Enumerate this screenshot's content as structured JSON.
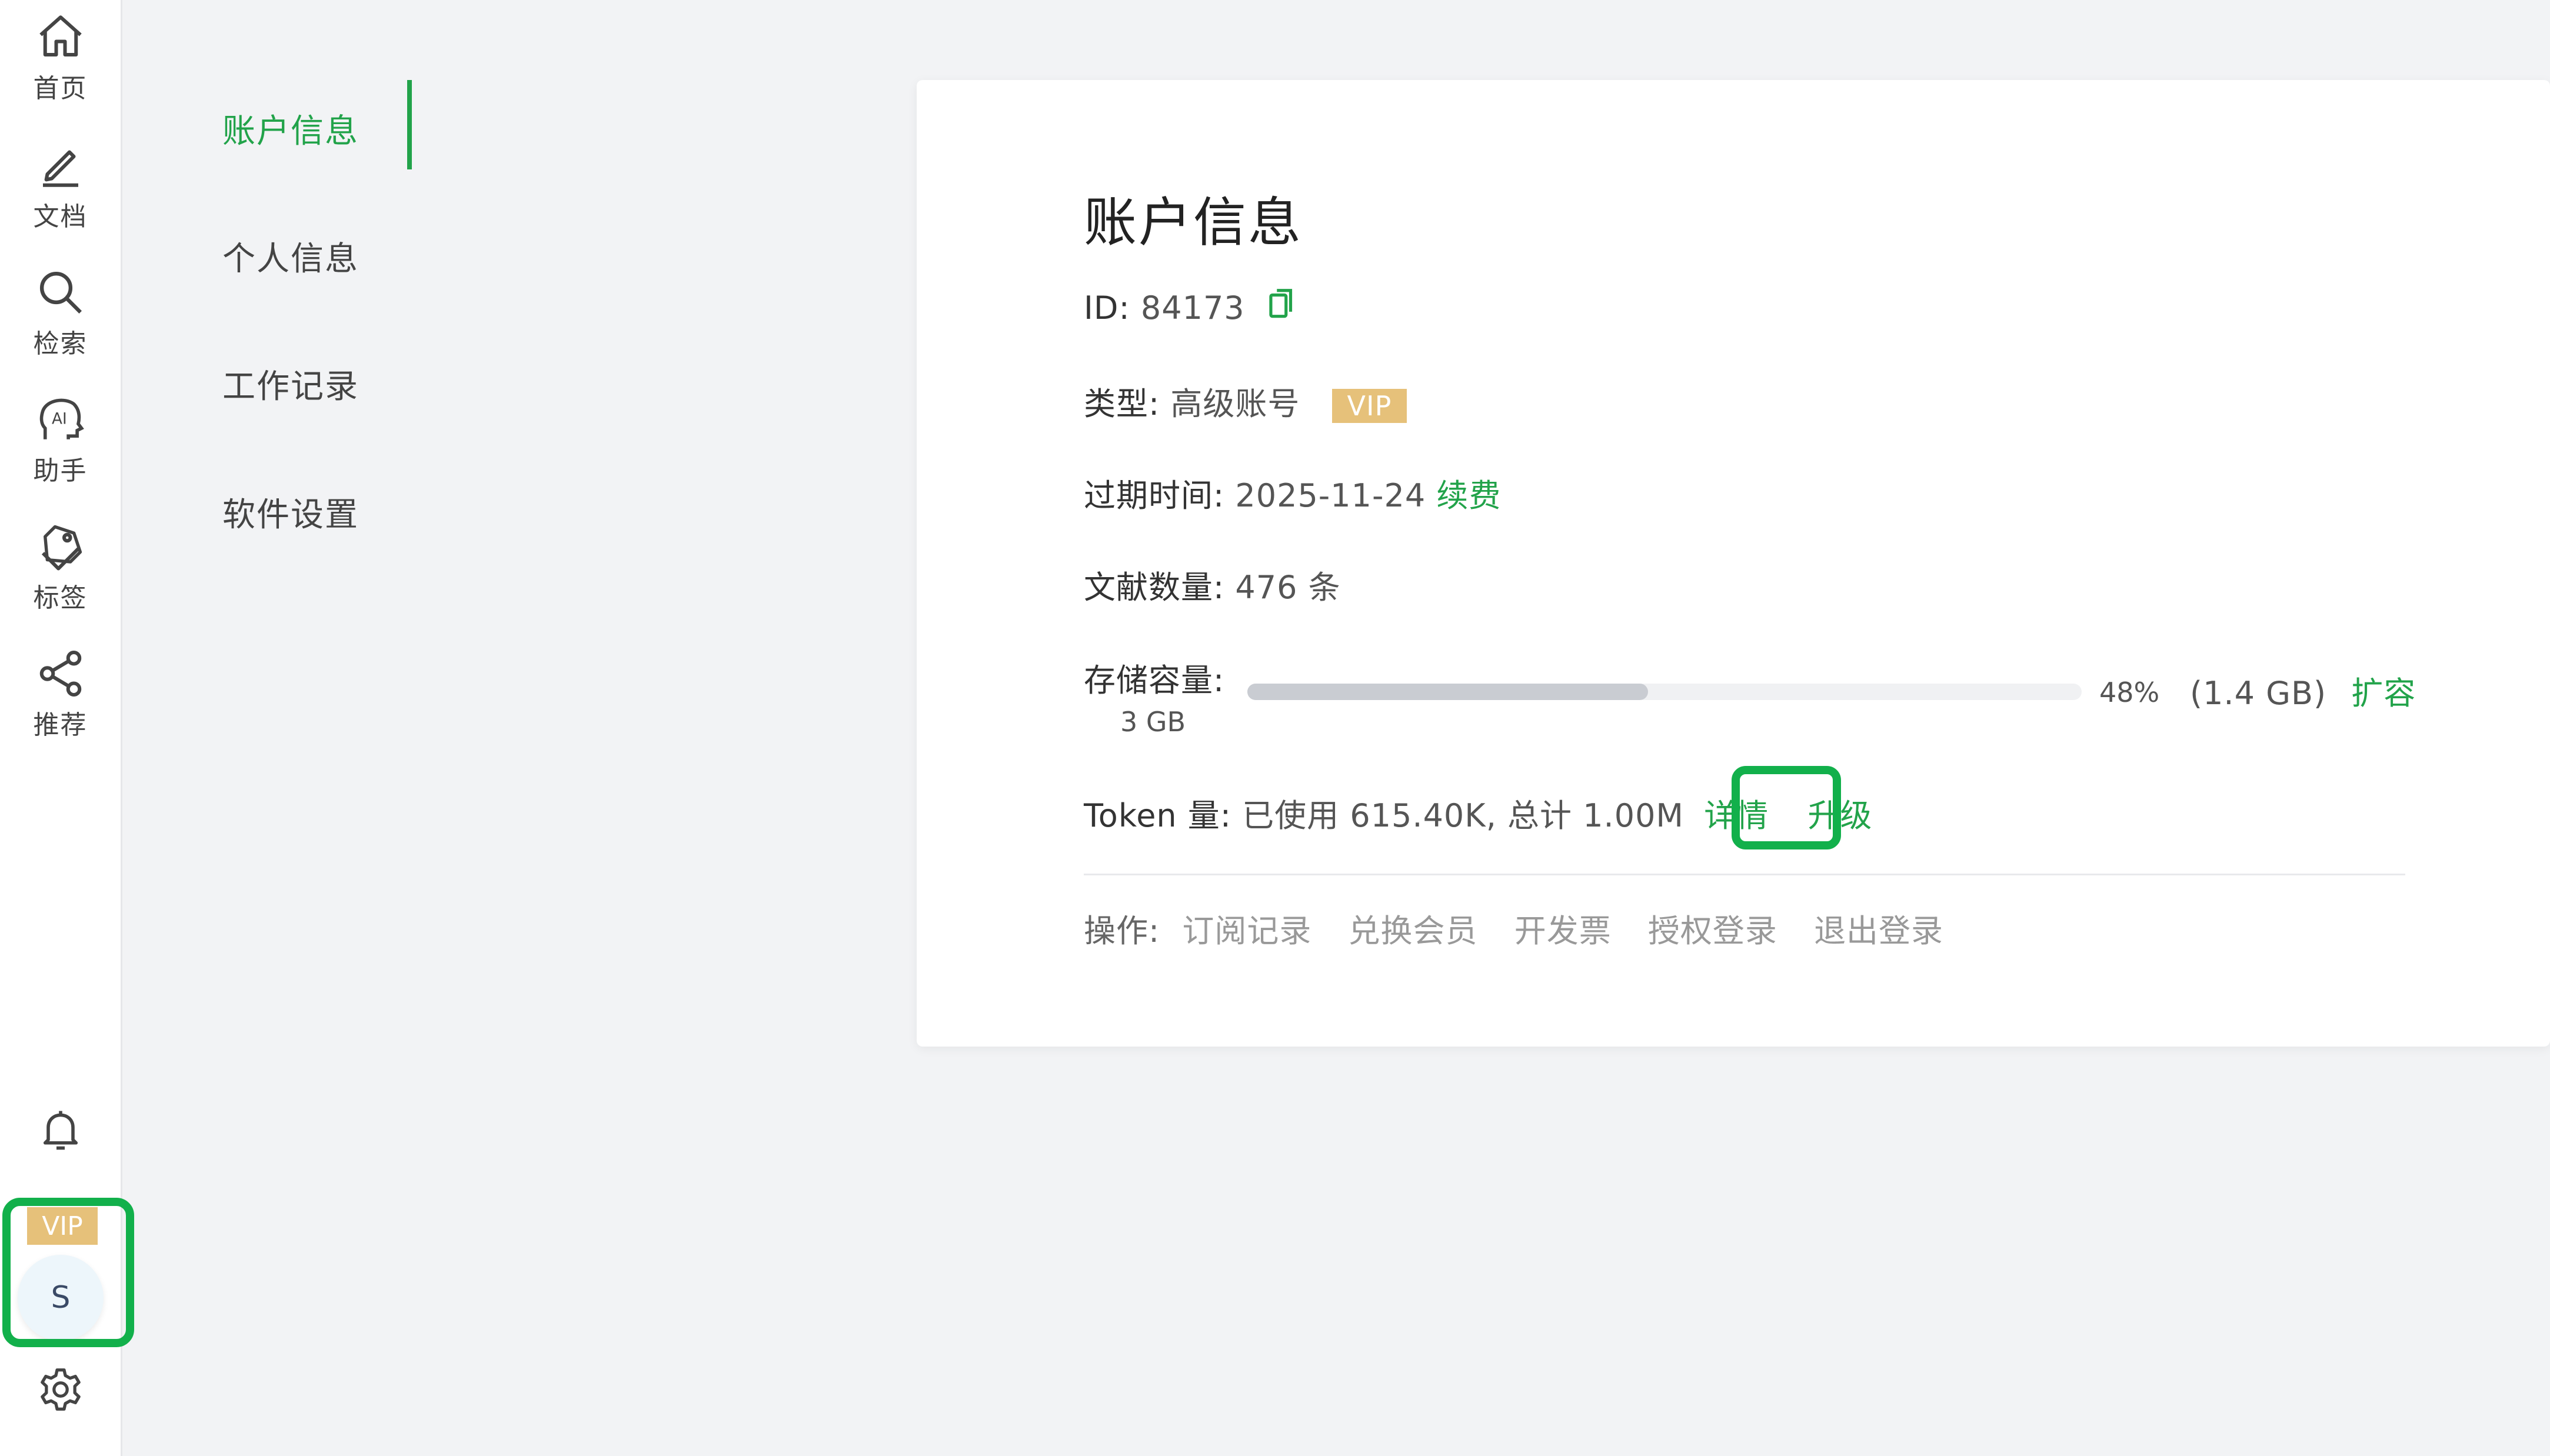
{
  "colors": {
    "accent": "#22a34a",
    "vip": "#e6c17a",
    "highlight": "#12b04b"
  },
  "sidebar": {
    "items": [
      {
        "label": "首页",
        "icon": "home-icon"
      },
      {
        "label": "文档",
        "icon": "edit-icon"
      },
      {
        "label": "检索",
        "icon": "search-icon"
      },
      {
        "label": "助手",
        "icon": "ai-assistant-icon"
      },
      {
        "label": "标签",
        "icon": "tag-icon"
      },
      {
        "label": "推荐",
        "icon": "share-icon"
      }
    ],
    "bottom": {
      "notification_icon": "bell-icon",
      "vip_label": "VIP",
      "avatar_initial": "S",
      "settings_icon": "gear-icon"
    }
  },
  "subnav": {
    "items": [
      {
        "label": "账户信息",
        "active": true
      },
      {
        "label": "个人信息",
        "active": false
      },
      {
        "label": "工作记录",
        "active": false
      },
      {
        "label": "软件设置",
        "active": false
      }
    ]
  },
  "account": {
    "title": "账户信息",
    "id_label": "ID:",
    "id_value": "84173",
    "type_label": "类型:",
    "type_value": "高级账号",
    "type_badge": "VIP",
    "expire_label": "过期时间:",
    "expire_value": "2025-11-24",
    "renew_link": "续费",
    "docs_label": "文献数量:",
    "docs_value": "476 条",
    "storage_label": "存储容量:",
    "storage_total": "3 GB",
    "storage_percent": 48,
    "storage_percent_text": "48%",
    "storage_used": "(1.4 GB)",
    "expand_link": "扩容",
    "token_label": "Token 量:",
    "token_value": "已使用 615.40K, 总计 1.00M",
    "token_details_link": "详情",
    "token_upgrade_link": "升级",
    "ops_label": "操作:",
    "ops": [
      "订阅记录",
      "兑换会员",
      "开发票",
      "授权登录",
      "退出登录"
    ]
  }
}
